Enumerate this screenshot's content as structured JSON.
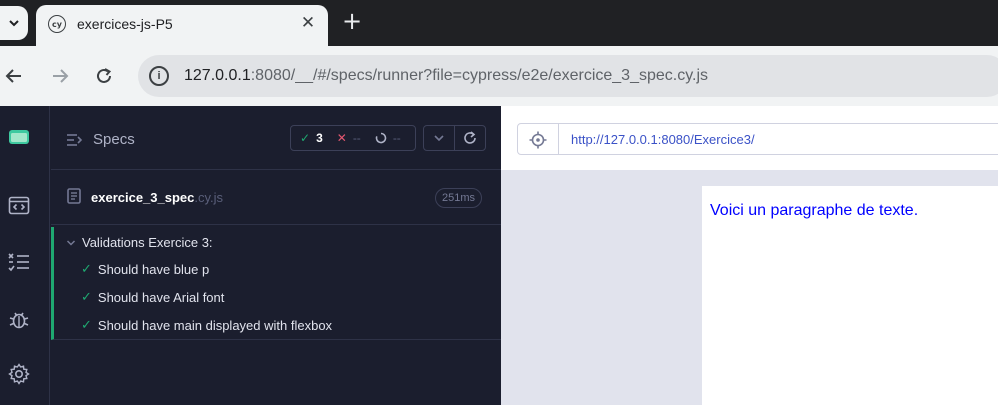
{
  "browser": {
    "tab_title": "exercices-js-P5",
    "tab_favicon": "cy",
    "url_host": "127.0.0.1",
    "url_rest": ":8080/__/#/specs/runner?file=cypress/e2e/exercice_3_spec.cy.js"
  },
  "sidebar": {
    "icons": [
      "cypress-logo-icon",
      "browser-code-icon",
      "test-list-icon",
      "bug-icon",
      "gear-icon"
    ]
  },
  "specs": {
    "title": "Specs",
    "passed": "3",
    "failed": "--",
    "pending": "--",
    "file_name": "exercice_3_spec",
    "file_ext": ".cy.js",
    "duration": "251ms"
  },
  "suite": {
    "title": "Validations Exercice 3:",
    "tests": [
      "Should have blue p",
      "Should have Arial font",
      "Should have main displayed with flexbox"
    ]
  },
  "aut": {
    "url": "http://127.0.0.1:8080/Exercice3/",
    "paragraph": "Voici un paragraphe de texte."
  },
  "colors": {
    "pass": "#1fa971",
    "fail": "#e45770",
    "link": "#3b52c7",
    "paragraph": "#0000ff"
  }
}
